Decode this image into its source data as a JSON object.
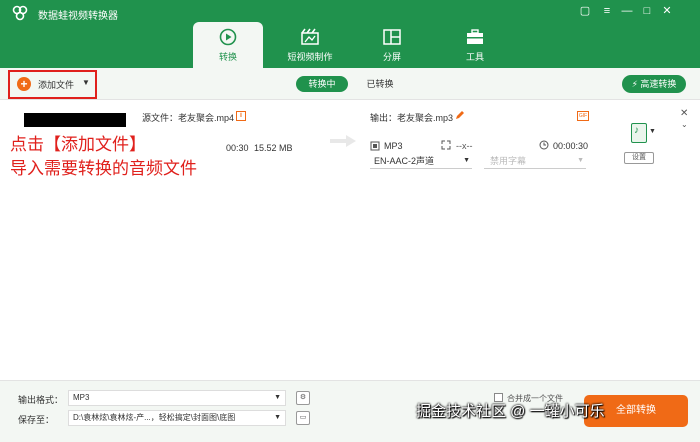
{
  "window": {
    "title": "数据蛙视频转换器",
    "controls": [
      "▢",
      "≡",
      "—",
      "□",
      "✕"
    ]
  },
  "main_tabs": [
    {
      "label": "转换",
      "icon": "convert-icon",
      "active": true
    },
    {
      "label": "短视频制作",
      "icon": "clapperboard-icon",
      "active": false
    },
    {
      "label": "分屏",
      "icon": "split-screen-icon",
      "active": false
    },
    {
      "label": "工具",
      "icon": "toolbox-icon",
      "active": false
    }
  ],
  "toolbar": {
    "add_file_label": "添加文件",
    "converting_label": "转换中",
    "converted_label": "已转换",
    "fast_convert_label": "高速转换"
  },
  "file": {
    "source_label": "源文件：老友聚会.mp4",
    "duration_fragment": "00:30",
    "size": "15.52 MB",
    "output_label": "输出：老友聚会.mp3",
    "output_badge": "GIF",
    "output_format": "MP3",
    "output_resolution": "--x--",
    "output_duration": "00:00:30",
    "audio_track": "EN-AAC-2声道",
    "subtitle": "禁用字幕",
    "settings_label": "设置",
    "close_glyph": "✕",
    "down_glyph": "⌄"
  },
  "annotation": {
    "line1": "点击【添加文件】",
    "line2": "导入需要转换的音频文件"
  },
  "bottom": {
    "output_format_label": "输出格式：",
    "output_format_value": "MP3",
    "save_to_label": "保存至：",
    "save_to_value": "D:\\袁林炫\\袁林炫-产...，轻松搞定\\封面图\\底图",
    "merge_label": "合并成一个文件",
    "convert_label": "全部转换"
  },
  "watermark": "掘金技术社区 @ 一罐小可乐",
  "colors": {
    "brand_green": "#20924d",
    "accent_orange": "#f06a16",
    "annotation_red": "#e0201c"
  }
}
